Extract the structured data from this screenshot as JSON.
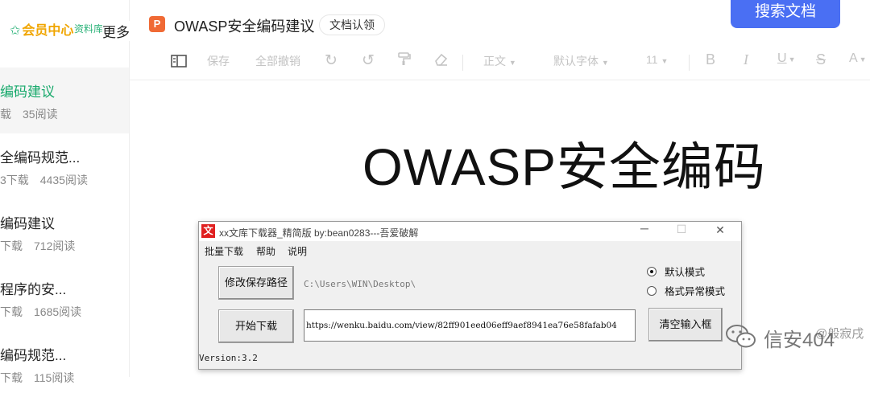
{
  "sidebar": {
    "logo_text": "会员中心",
    "member_link": "资料库",
    "more": "更多",
    "items": [
      {
        "title": "编码建议",
        "downloads": "载",
        "reads": "35阅读",
        "active": true
      },
      {
        "title": "全编码规范...",
        "downloads": "3下载",
        "reads": "4435阅读"
      },
      {
        "title": "编码建议",
        "downloads": "下载",
        "reads": "712阅读"
      },
      {
        "title": "程序的安...",
        "downloads": "下载",
        "reads": "1685阅读"
      },
      {
        "title": "编码规范...",
        "downloads": "下载",
        "reads": "115阅读"
      }
    ]
  },
  "header": {
    "file_icon": "P",
    "doc_name": "OWASP安全编码建议",
    "claim_tag": "文档认领",
    "search_button": "搜索文档"
  },
  "toolbar": {
    "save": "保存",
    "undo_all": "全部撤销",
    "style": "正文",
    "font": "默认字体",
    "size": "11",
    "bold": "B",
    "italic": "I",
    "underline": "U",
    "strike": "S",
    "color": "A"
  },
  "document": {
    "heading": "OWASP安全编码"
  },
  "downloader": {
    "icon": "文",
    "title": "xx文库下载器_精简版  by:bean0283---吾爱破解",
    "menu": [
      "批量下载",
      "帮助",
      "说明"
    ],
    "change_path_button": "修改保存路径",
    "save_path": "C:\\Users\\WIN\\Desktop\\",
    "start_button": "开始下载",
    "url_value": "https://wenku.baidu.com/view/82ff901eed06eff9aef8941ea76e58fafab04",
    "clear_button": "清空输入框",
    "mode_default": "默认模式",
    "mode_format": "格式异常模式",
    "version": "Version:3.2"
  },
  "watermark": {
    "text": "信安404",
    "text2": "@般寂戌"
  }
}
